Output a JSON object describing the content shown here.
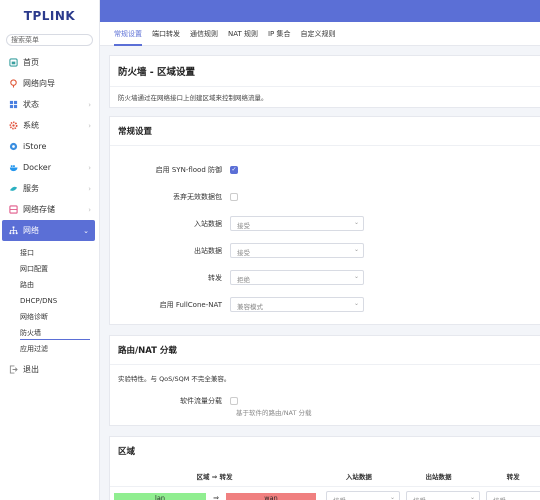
{
  "logo": "TPLINK",
  "search": {
    "placeholder": "搜索菜单"
  },
  "sidebar": {
    "items": [
      {
        "label": "首页",
        "icon": "home-icon"
      },
      {
        "label": "网络向导",
        "icon": "wizard-icon"
      },
      {
        "label": "状态",
        "icon": "status-icon",
        "chev": "›"
      },
      {
        "label": "系统",
        "icon": "system-gear-icon",
        "chev": "›"
      },
      {
        "label": "iStore",
        "icon": "store-icon"
      },
      {
        "label": "Docker",
        "icon": "docker-icon",
        "chev": "›"
      },
      {
        "label": "服务",
        "icon": "services-icon",
        "chev": "›"
      },
      {
        "label": "网络存储",
        "icon": "storage-icon",
        "chev": "›"
      },
      {
        "label": "网络",
        "icon": "network-icon",
        "chev": "⌄",
        "active": true
      }
    ],
    "submenu": [
      "接口",
      "网口配置",
      "路由",
      "DHCP/DNS",
      "网络诊断",
      "防火墙",
      "应用过滤"
    ],
    "logout": "退出"
  },
  "tabs": [
    "常规设置",
    "端口转发",
    "通信规则",
    "NAT 规则",
    "IP 集合",
    "自定义规则"
  ],
  "page": {
    "title": "防火墙 - 区域设置",
    "desc": "防火墙通过在网络接口上创建区域来控制网络流量。"
  },
  "general": {
    "title": "常规设置",
    "syn_label": "启用 SYN-flood 防御",
    "drop_label": "丢弃无效数据包",
    "input_label": "入站数据",
    "input_value": "接受",
    "output_label": "出站数据",
    "output_value": "接受",
    "forward_label": "转发",
    "forward_value": "拒绝",
    "fullcone_label": "启用 FullCone-NAT",
    "fullcone_value": "兼容模式"
  },
  "offload": {
    "title": "路由/NAT 分载",
    "note": "实验特性。与 QoS/SQM 不完全兼容。",
    "sw_label": "软件流量分载",
    "sw_hint": "基于软件的路由/NAT 分载"
  },
  "zones": {
    "title": "区域",
    "col_zone": "区域 ⇒ 转发",
    "col_input": "入站数据",
    "col_output": "出站数据",
    "col_forward": "转发",
    "row": {
      "src": "lan",
      "arrow": "⇒",
      "dst": "wan",
      "input": "接受",
      "output": "接受",
      "forward": "接受"
    }
  },
  "colors": {
    "accent": "#5b6fd6",
    "lan": "#90ee90",
    "wan": "#f08080"
  }
}
